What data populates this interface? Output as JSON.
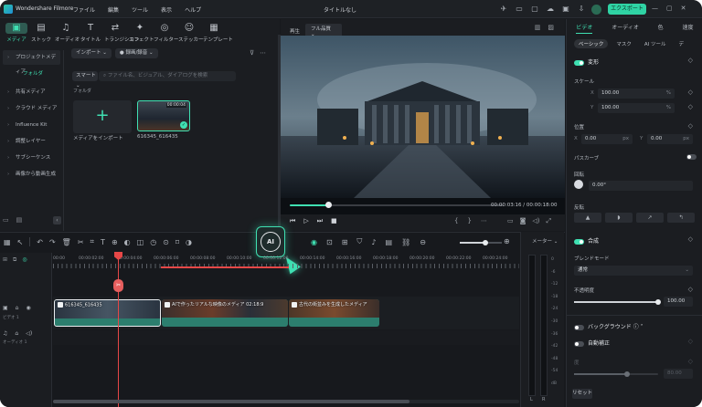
{
  "titlebar": {
    "app_name": "Wondershare Filmore",
    "menu": [
      "ファイル",
      "編集",
      "ツール",
      "表示",
      "ヘルプ"
    ],
    "doc_title": "タイトルなし",
    "export_label": "エクスポート",
    "export_chevron": "⌄"
  },
  "toolbar": {
    "items": [
      {
        "icon": "media-icon",
        "glyph": "▣",
        "label": "メディア"
      },
      {
        "icon": "stock-icon",
        "glyph": "▤",
        "label": "ストック"
      },
      {
        "icon": "audio-icon",
        "glyph": "♫",
        "label": "オーディオ"
      },
      {
        "icon": "title-icon",
        "glyph": "T",
        "label": "タイトル"
      },
      {
        "icon": "transition-icon",
        "glyph": "⇄",
        "label": "トランジション"
      },
      {
        "icon": "effect-icon",
        "glyph": "✦",
        "label": "エフェクト"
      },
      {
        "icon": "filter-icon",
        "glyph": "◎",
        "label": "フィルター"
      },
      {
        "icon": "sticker-icon",
        "glyph": "☺",
        "label": "ステッカー"
      },
      {
        "icon": "template-icon",
        "glyph": "▦",
        "label": "テンプレート"
      }
    ]
  },
  "sidebar": {
    "project_media": "プロジェクトメディア",
    "folder": "フォルダ",
    "items": [
      "共有メディア",
      "クラウド メディア",
      "Influence Kit",
      "調整レイヤー",
      "サブシーケンス",
      "画像から動画生成"
    ]
  },
  "media": {
    "import_label": "インポート",
    "record_label": "録画/録音",
    "smart_label": "スマート",
    "search_placeholder": "ファイル名、ビジュアル、ダイアログを検索",
    "folder_label": "フォルダ",
    "import_tile_label": "メディアをインポート",
    "clip_label": "616345_616435",
    "clip_duration": "00:00:04"
  },
  "preview": {
    "mode_label": "再生",
    "quality_label": "フル品質",
    "current_time": "00:00:03:16",
    "total_time": "00:00:18:00",
    "progress": 0.18
  },
  "properties": {
    "tabs": [
      "ビデオ",
      "オーディオ",
      "色",
      "速度"
    ],
    "subtabs": [
      "ベーシック",
      "マスク",
      "AI ツール",
      "デ"
    ],
    "transform_label": "変形",
    "scale_label": "スケール",
    "scale_x": "100.00",
    "scale_y": "100.00",
    "scale_unit": "%",
    "position_label": "位置",
    "pos_x": "0.00",
    "pos_y": "0.00",
    "pos_unit": "px",
    "path_curve_label": "パスカーブ",
    "rotation_label": "回転",
    "rotation_value": "0.00°",
    "flip_label": "反転",
    "composite_label": "合成",
    "blend_mode_label": "ブレンドモード",
    "blend_mode_value": "通常",
    "opacity_label": "不透明度",
    "opacity_value": "100.00",
    "background_label": "バックグラウンド",
    "auto_correct_label": "自動補正",
    "sub_label": "度",
    "disabled_value": "80.00",
    "reset_label": "リセット"
  },
  "timeline": {
    "ruler": [
      "00:00",
      "00:00:02:00",
      "00:00:04:00",
      "00:00:06:00",
      "00:00:08:00",
      "00:00:10:00",
      "00:00:12:00",
      "00:00:14:00",
      "00:00:16:00",
      "00:00:18:00",
      "00:00:20:00",
      "00:00:22:00",
      "00:00:24:00"
    ],
    "video_track_label": "ビデオ 1",
    "audio_track_label": "オーディオ 1",
    "clips": [
      "616345_616435",
      "AIで作ったリアルな映像のメディア 02:18:9",
      "古代の街並みを生成したメディア"
    ],
    "ai_badge": "AI"
  },
  "meter": {
    "title": "メーター",
    "scale": [
      "0",
      "-6",
      "-12",
      "-18",
      "-24",
      "-30",
      "-36",
      "-42",
      "-48",
      "-54",
      "dB"
    ],
    "left": "L",
    "right": "R"
  }
}
